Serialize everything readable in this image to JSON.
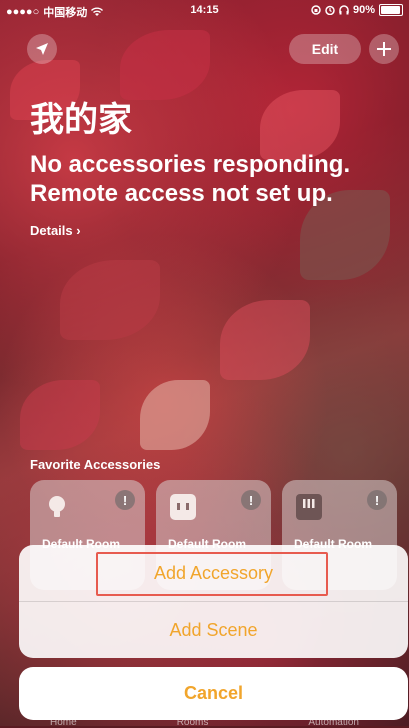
{
  "status_bar": {
    "signal": "●●●●○",
    "carrier": "中国移动",
    "time": "14:15",
    "battery": "90%"
  },
  "header": {
    "edit_label": "Edit",
    "home_title": "我的家",
    "status_line_1": "No accessories responding.",
    "status_line_2": "Remote access not set up.",
    "details_label": "Details ›"
  },
  "favorites": {
    "header": "Favorite Accessories",
    "tiles": [
      {
        "room": "Default Room",
        "icon": "lightbulb-icon"
      },
      {
        "room": "Default Room",
        "icon": "outlet-icon"
      },
      {
        "room": "Default Room",
        "icon": "switch-icon"
      }
    ],
    "alert_symbol": "!"
  },
  "action_sheet": {
    "items": [
      {
        "label": "Add Accessory"
      },
      {
        "label": "Add Scene"
      }
    ],
    "cancel_label": "Cancel",
    "accent_color": "#f1a52c",
    "highlight_color": "#e75b4f"
  },
  "tab_bar": {
    "items": [
      "Home",
      "Rooms",
      "Automation"
    ]
  }
}
